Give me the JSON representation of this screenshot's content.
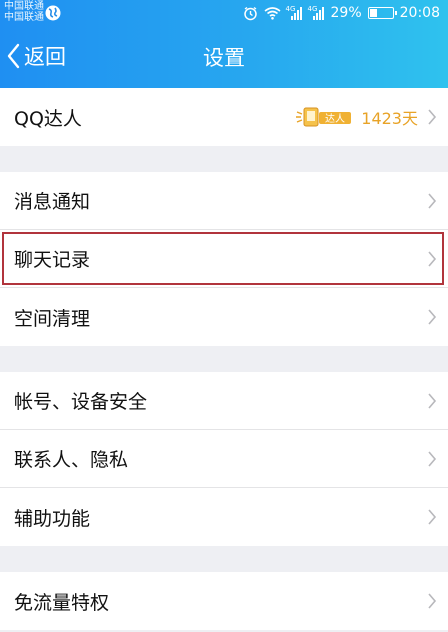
{
  "status": {
    "carrier_line1": "中国联通",
    "carrier_line2": "中国联通",
    "battery_percent": "29%",
    "battery_level": 0.29,
    "time": "20:08",
    "net_label_1": "4G",
    "net_label_2": "4G"
  },
  "header": {
    "back_label": "返回",
    "title": "设置"
  },
  "qq_daren": {
    "label": "QQ达人",
    "badge_text": "达人",
    "days": "1423天"
  },
  "groups": [
    {
      "items": [
        {
          "label": "消息通知",
          "name": "row-message-notifications"
        },
        {
          "label": "聊天记录",
          "name": "row-chat-history",
          "highlighted": true
        },
        {
          "label": "空间清理",
          "name": "row-storage-cleanup"
        }
      ]
    },
    {
      "items": [
        {
          "label": "帐号、设备安全",
          "name": "row-account-device-security"
        },
        {
          "label": "联系人、隐私",
          "name": "row-contacts-privacy"
        },
        {
          "label": "辅助功能",
          "name": "row-accessibility"
        }
      ]
    },
    {
      "items": [
        {
          "label": "免流量特权",
          "name": "row-free-data-privilege"
        }
      ]
    }
  ],
  "colors": {
    "header_gradient_start": "#1f8ff2",
    "header_gradient_end": "#2fc2ee",
    "accent_gold": "#e8a327",
    "highlight_red": "#b1343c",
    "background": "#eeeff3"
  },
  "icons": {
    "back": "chevron-left-icon",
    "row": "chevron-right-icon",
    "badge": "qq-daren-badge-icon"
  }
}
